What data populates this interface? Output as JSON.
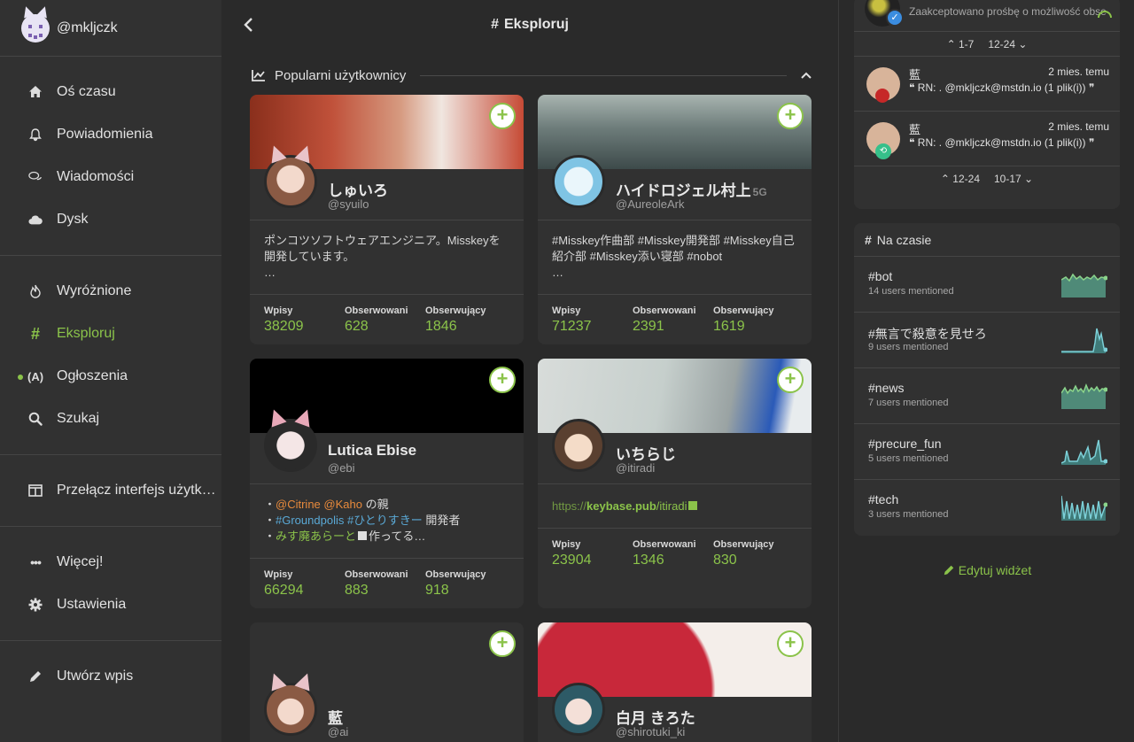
{
  "account": {
    "handle": "@mkljczk"
  },
  "nav": {
    "group1": [
      {
        "label": "Oś czasu",
        "icon": "home-icon"
      },
      {
        "label": "Powiadomienia",
        "icon": "bell-icon"
      },
      {
        "label": "Wiadomości",
        "icon": "comments-icon"
      },
      {
        "label": "Dysk",
        "icon": "cloud-icon"
      }
    ],
    "group2": [
      {
        "label": "Wyróżnione",
        "icon": "fire-icon"
      },
      {
        "label": "Eksploruj",
        "icon": "hashtag-icon"
      },
      {
        "label": "Ogłoszenia",
        "icon": "broadcast-icon"
      },
      {
        "label": "Szukaj",
        "icon": "search-icon"
      }
    ],
    "switch_ui": "Przełącz interfejs użytk…",
    "more": "Więcej!",
    "settings": "Ustawienia",
    "compose": "Utwórz wpis"
  },
  "main": {
    "title": "Eksploruj",
    "section": "Popularni użytkownicy",
    "stat_labels": {
      "posts": "Wpisy",
      "following": "Obserwowani",
      "followers": "Obserwujący"
    },
    "users": [
      {
        "name": "しゅいろ",
        "acct": "@syuilo",
        "desc1": "ポンコツソフトウェアエンジニア。Misskeyを",
        "desc2": "開発しています。",
        "desc3": "…",
        "posts": "38209",
        "following": "628",
        "followers": "1846"
      },
      {
        "name": "ハイドロジェル村上",
        "name_badge": "5G",
        "acct": "@AureoleArk",
        "desc1": "#Misskey作曲部 #Misskey開発部 #Misskey自己",
        "desc2": "紹介部 #Misskey添い寝部 #nobot",
        "desc3": "…",
        "posts": "71237",
        "following": "2391",
        "followers": "1619"
      },
      {
        "name": "Lutica Ebise",
        "acct": "@ebi",
        "desc1a": "・",
        "desc1b": "@Citrine",
        "desc1c": "@Kaho",
        "desc1d": " の親",
        "desc2a": "・",
        "desc2b": "#Groundpolis",
        "desc2c": "#ひとりすきー",
        "desc2d": " 開発者",
        "desc3a": "・",
        "desc3b": "みす廃あらーと",
        "desc3c": "作ってる…",
        "posts": "66294",
        "following": "883",
        "followers": "918"
      },
      {
        "name": "いちらじ",
        "acct": "@itiradi",
        "link_prefix": "https://",
        "link_host": "keybase.pub",
        "link_path": "/itiradi",
        "posts": "23904",
        "following": "1346",
        "followers": "830"
      },
      {
        "name": "藍",
        "acct": "@ai"
      },
      {
        "name": "白月 きろた",
        "acct": "@shirotuki_ki"
      }
    ]
  },
  "right": {
    "notif_text": "Zaakceptowano prośbę o możliwość obse",
    "pager1": {
      "prev": "1-7",
      "next": "12-24"
    },
    "notes": [
      {
        "name": "藍",
        "time": "2 mies. temu",
        "text": "RN: . @mkljczk@mstdn.io (1 plik(i))"
      },
      {
        "name": "藍",
        "time": "2 mies. temu",
        "text": "RN: . @mkljczk@mstdn.io (1 plik(i))"
      }
    ],
    "pager2": {
      "prev": "12-24",
      "next": "10-17"
    },
    "trends_title": "Na czasie",
    "trends": [
      {
        "tag": "#bot",
        "count": "14 users mentioned"
      },
      {
        "tag": "#無言で殺意を見せろ",
        "count": "9 users mentioned"
      },
      {
        "tag": "#news",
        "count": "7 users mentioned"
      },
      {
        "tag": "#precure_fun",
        "count": "5 users mentioned"
      },
      {
        "tag": "#tech",
        "count": "3 users mentioned"
      }
    ],
    "edit_widgets": "Edytuj widżet"
  },
  "colors": {
    "accent": "#8bc34a",
    "bg": "#2a2a2a",
    "panel": "#313131"
  }
}
